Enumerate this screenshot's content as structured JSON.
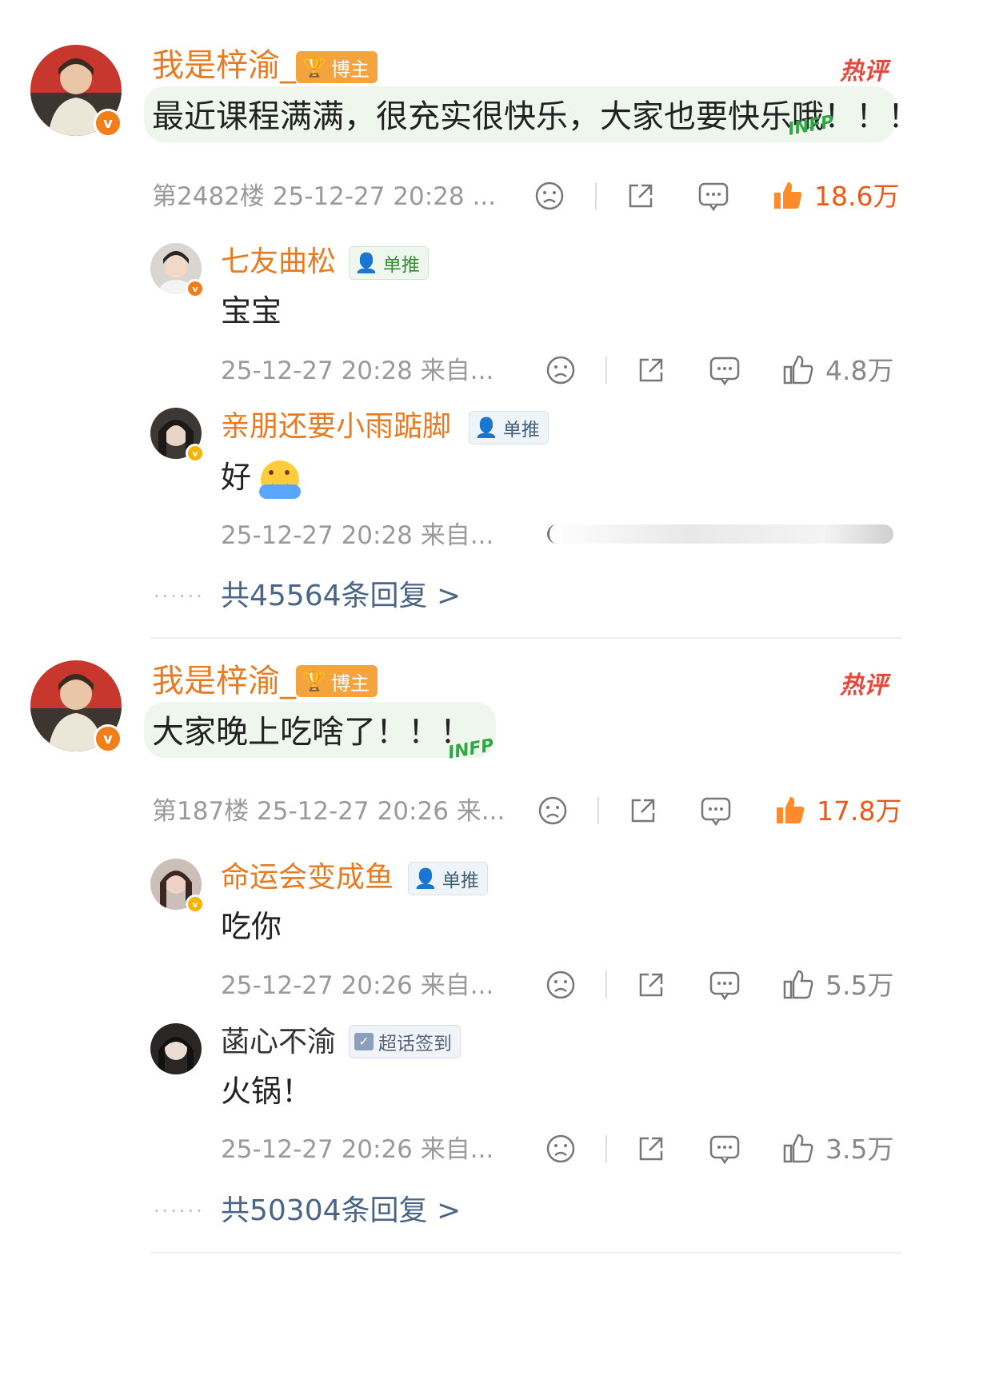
{
  "comments": [
    {
      "author": "我是梓渝_",
      "badge": "博主",
      "hot": "热评",
      "text": "最近课程满满，很充实很快乐，大家也要快乐哦！！！",
      "sticker": "INFP",
      "meta": "第2482楼 25-12-27 20:28 ...",
      "likes": "18.6万",
      "replies": [
        {
          "author": "七友曲松",
          "badge": "单推",
          "text": "宝宝",
          "meta": "25-12-27 20:28 来自...",
          "likes": "4.8万"
        },
        {
          "author": "亲朋还要小雨踮脚",
          "badge": "单推",
          "text": "好",
          "emoji": "hug-emoji",
          "meta": "25-12-27 20:28 来自..."
        }
      ],
      "more": "共45564条回复 >"
    },
    {
      "author": "我是梓渝_",
      "badge": "博主",
      "hot": "热评",
      "text": "大家晚上吃啥了！！！",
      "sticker": "INFP",
      "meta": "第187楼 25-12-27 20:26 来...",
      "likes": "17.8万",
      "replies": [
        {
          "author": "命运会变成鱼",
          "badge": "单推",
          "text": "吃你",
          "meta": "25-12-27 20:26 来自...",
          "likes": "5.5万"
        },
        {
          "author": "菡心不渝",
          "badge": "超话签到",
          "text": "火锅！",
          "meta": "25-12-27 20:26 来自...",
          "likes": "3.5万"
        }
      ],
      "more": "共50304条回复 >"
    }
  ],
  "colors": {
    "accent": "#e77b22",
    "like_hot": "#e85b19",
    "link": "#4a6585",
    "bubble": "#eef6ee"
  },
  "dots": "······"
}
